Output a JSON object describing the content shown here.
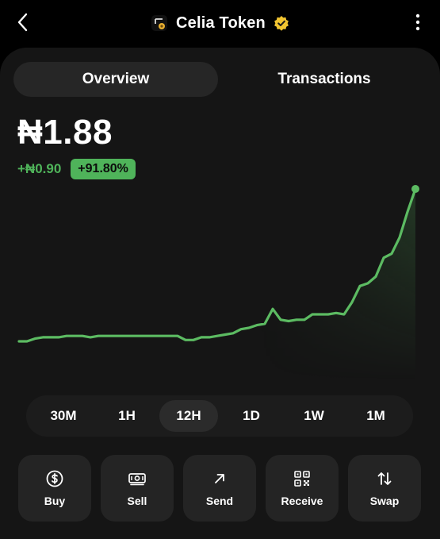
{
  "header": {
    "title": "Celia Token",
    "back_icon": "chevron-left-icon",
    "verified_icon": "verified-badge-icon",
    "more_icon": "more-vertical-icon",
    "verified_color": "#f2c531"
  },
  "tabs": [
    {
      "label": "Overview",
      "active": true
    },
    {
      "label": "Transactions",
      "active": false
    }
  ],
  "price": {
    "value": "₦1.88",
    "change_abs": "+₦0.90",
    "change_pct": "+91.80%",
    "positive_color": "#4fb35a"
  },
  "chart_data": {
    "type": "line",
    "x": [
      0,
      1,
      2,
      3,
      4,
      5,
      6,
      7,
      8,
      9,
      10,
      11,
      12,
      13,
      14,
      15,
      16,
      17,
      18,
      19,
      20,
      21,
      22,
      23,
      24,
      25,
      26,
      27,
      28,
      29,
      30,
      31,
      32,
      33,
      34,
      35,
      36,
      37,
      38,
      39,
      40,
      41,
      42,
      43,
      44,
      45,
      46,
      47,
      48,
      49,
      50
    ],
    "values": [
      0.75,
      0.75,
      0.77,
      0.78,
      0.78,
      0.78,
      0.79,
      0.79,
      0.79,
      0.78,
      0.79,
      0.79,
      0.79,
      0.79,
      0.79,
      0.79,
      0.79,
      0.79,
      0.79,
      0.79,
      0.79,
      0.76,
      0.76,
      0.78,
      0.78,
      0.79,
      0.8,
      0.81,
      0.84,
      0.85,
      0.87,
      0.88,
      0.99,
      0.91,
      0.9,
      0.91,
      0.91,
      0.95,
      0.95,
      0.95,
      0.96,
      0.95,
      1.04,
      1.16,
      1.18,
      1.23,
      1.37,
      1.4,
      1.52,
      1.71,
      1.88
    ],
    "line_color": "#5cbb62",
    "grid": false,
    "axes_visible": false
  },
  "ranges": [
    {
      "label": "30M",
      "active": false
    },
    {
      "label": "1H",
      "active": false
    },
    {
      "label": "12H",
      "active": true
    },
    {
      "label": "1D",
      "active": false
    },
    {
      "label": "1W",
      "active": false
    },
    {
      "label": "1M",
      "active": false
    }
  ],
  "actions": [
    {
      "label": "Buy",
      "icon": "dollar-circle-icon"
    },
    {
      "label": "Sell",
      "icon": "cash-icon"
    },
    {
      "label": "Send",
      "icon": "arrow-up-right-icon"
    },
    {
      "label": "Receive",
      "icon": "qr-code-icon"
    },
    {
      "label": "Swap",
      "icon": "swap-arrows-icon"
    }
  ]
}
